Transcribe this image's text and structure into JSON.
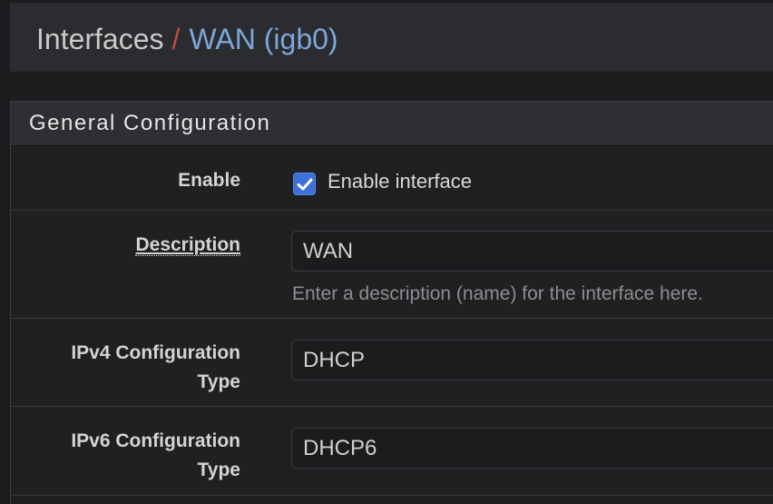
{
  "breadcrumb": {
    "parent": "Interfaces",
    "separator": "/",
    "current": "WAN (igb0)"
  },
  "panel": {
    "title": "General Configuration"
  },
  "enable": {
    "label": "Enable",
    "checkbox_label": "Enable interface",
    "checked": true
  },
  "description": {
    "label": "Description",
    "value": "WAN",
    "help": "Enter a description (name) for the interface here."
  },
  "ipv4": {
    "label_line1": "IPv4 Configuration",
    "label_line2": "Type",
    "value": "DHCP"
  },
  "ipv6": {
    "label_line1": "IPv6 Configuration",
    "label_line2": "Type",
    "value": "DHCP6"
  },
  "colors": {
    "accent": "#3d6fd8",
    "breadcrumb_current": "#7da7d8",
    "breadcrumb_separator": "#c94a43"
  },
  "icons": {
    "checkbox": "check-icon"
  }
}
